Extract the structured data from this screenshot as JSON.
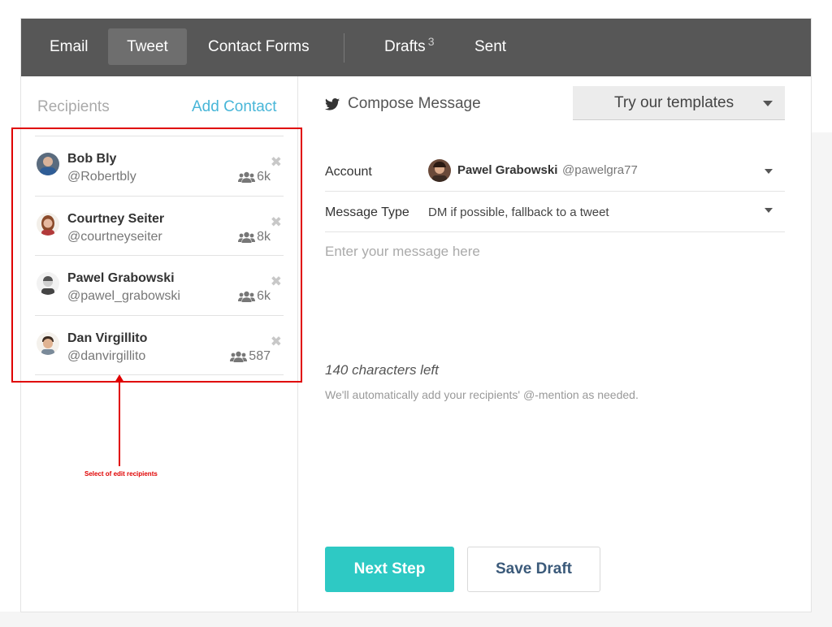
{
  "nav": {
    "items": [
      {
        "label": "Email"
      },
      {
        "label": "Tweet"
      },
      {
        "label": "Contact Forms"
      },
      {
        "label": "Drafts",
        "badge": "3"
      },
      {
        "label": "Sent"
      }
    ]
  },
  "recipients": {
    "title": "Recipients",
    "add_label": "Add Contact",
    "items": [
      {
        "name": "Bob Bly",
        "handle": "@Robertbly",
        "followers": "6k",
        "remove": "✖"
      },
      {
        "name": "Courtney Seiter",
        "handle": "@courtneyseiter",
        "followers": "8k",
        "remove": "✖"
      },
      {
        "name": "Pawel Grabowski",
        "handle": "@pawel_grabowski",
        "followers": "6k",
        "remove": "✖"
      },
      {
        "name": "Dan Virgillito",
        "handle": "@danvirgillito",
        "followers": "587",
        "remove": "✖"
      }
    ]
  },
  "annotation": {
    "text": "Select of edit recipients",
    "color": "#e00000"
  },
  "compose": {
    "title": "Compose Message",
    "templates_label": "Try our templates",
    "account_label": "Account",
    "account_name": "Pawel Grabowski",
    "account_handle": "@pawelgra77",
    "message_type_label": "Message Type",
    "message_type_value": "DM if possible, fallback to a tweet",
    "message_placeholder": "Enter your message here",
    "chars_left": "140 characters left",
    "hint": "We'll automatically add your recipients' @-mention as needed.",
    "next_label": "Next Step",
    "draft_label": "Save Draft"
  },
  "colors": {
    "nav_bg": "#575757",
    "accent_teal": "#2ec9c4",
    "link_blue": "#48b6d8",
    "annotation_red": "#e00000"
  }
}
